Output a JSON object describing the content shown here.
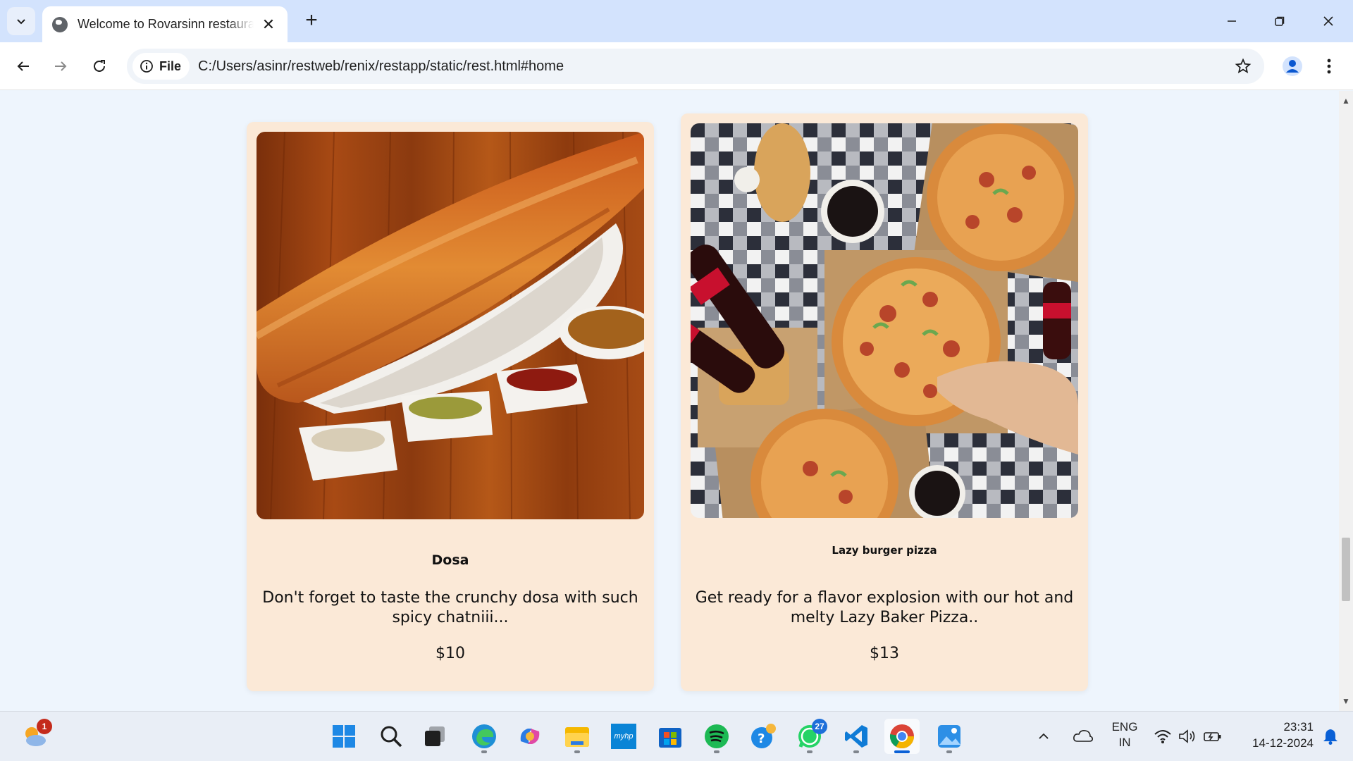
{
  "browser": {
    "tab_title": "Welcome to Rovarsinn restaurant",
    "close_tab_symbol": "✕",
    "new_tab_symbol": "+",
    "site_chip_label": "File",
    "url": "C:/Users/asinr/restweb/renix/restapp/static/rest.html#home",
    "icons": [
      "tab-search-icon",
      "globe-icon",
      "close-icon",
      "minimize-icon",
      "restore-icon",
      "back-icon",
      "forward-icon",
      "reload-icon",
      "info-icon",
      "star-icon",
      "profile-icon",
      "kebab-menu-icon"
    ]
  },
  "menu_items": [
    {
      "name": "Dosa",
      "description": "Don't forget to taste the crunchy dosa with such spicy chatniii...",
      "price": "$10",
      "image": "dosa-photo"
    },
    {
      "name": "Lazy burger pizza",
      "description": "Get ready for a flavor explosion with our hot and melty Lazy Baker Pizza..",
      "price": "$13",
      "image": "pizza-photo"
    }
  ],
  "taskbar": {
    "weather_badge": "1",
    "whatsapp_badge": "27",
    "apps": [
      "weather-icon",
      "start-icon",
      "search-icon",
      "task-view-icon",
      "edge-icon",
      "copilot-icon",
      "file-explorer-icon",
      "myhp-icon",
      "store-icon",
      "spotify-icon",
      "skype-icon",
      "whatsapp-icon",
      "vscode-icon",
      "chrome-icon",
      "photos-icon"
    ],
    "myhp_label": "myhp",
    "language": "ENG",
    "region": "IN",
    "time": "23:31",
    "date": "14-12-2024"
  },
  "colors": {
    "card_bg": "#fbe9d7",
    "page_bg": "#eef5fd",
    "tab_strip": "#d3e3fd",
    "accent": "#0a60d6"
  }
}
